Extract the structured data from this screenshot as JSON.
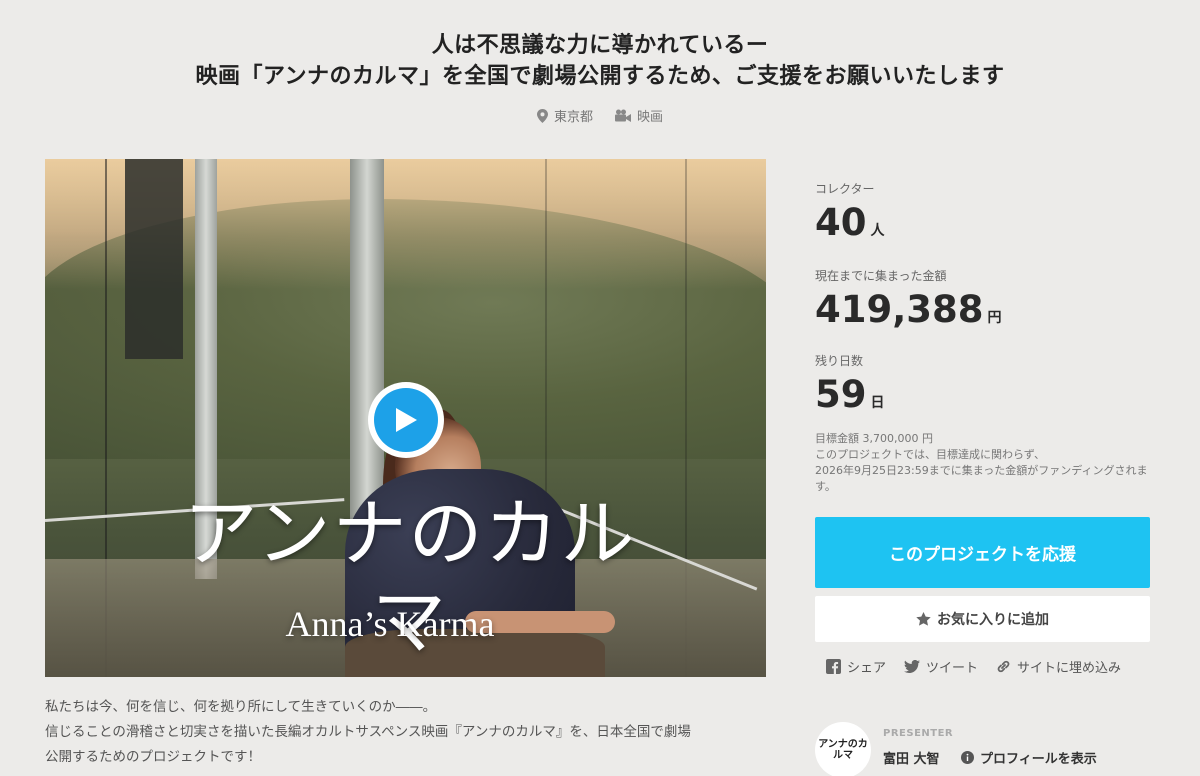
{
  "header": {
    "title_line1": "人は不思議な力に導かれているー",
    "title_line2": "映画「アンナのカルマ」を全国で劇場公開するため、ご支援をお願いいたします",
    "location": "東京都",
    "category": "映画",
    "location_icon": "map-pin-icon",
    "category_icon": "video-camera-icon"
  },
  "video": {
    "title_jp": "アンナのカルマ",
    "title_en": "Anna’s Karma",
    "play_icon": "play-icon"
  },
  "stats": {
    "collectors_label": "コレクター",
    "collectors_value": "40",
    "collectors_unit": "人",
    "amount_label": "現在までに集まった金額",
    "amount_value": "419,388",
    "amount_unit": "円",
    "days_label": "残り日数",
    "days_value": "59",
    "days_unit": "日",
    "goal_text": "目標金額 3,700,000 円",
    "note_line1": "このプロジェクトでは、目標達成に関わらず、",
    "note_line2": "2026年9月25日23:59までに集まった金額がファンディングされます。"
  },
  "actions": {
    "support_label": "このプロジェクトを応援",
    "favorite_label": "お気に入りに追加",
    "share_label": "シェア",
    "tweet_label": "ツイート",
    "embed_label": "サイトに埋め込み"
  },
  "description": {
    "line1": "私たちは今、何を信じ、何を拠り所にして生きていくのか――。",
    "line2": "信じることの滑稽さと切実さを描いた長編オカルトサスペンス映画『アンナのカルマ』を、日本全国で劇場",
    "line3": "公開するためのプロジェクトです！"
  },
  "presenter": {
    "role": "PRESENTER",
    "name": "富田 大智",
    "profile_label": "プロフィールを表示",
    "avatar_text": "アンナのカルマ"
  },
  "colors": {
    "accent": "#1ec3f2",
    "play": "#1da1e8",
    "background": "#ecebe9"
  }
}
